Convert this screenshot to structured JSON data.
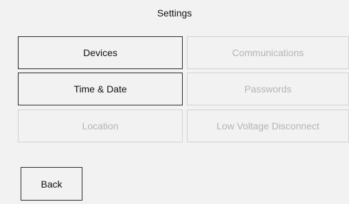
{
  "header": {
    "title": "Settings"
  },
  "menu": {
    "devices_label": "Devices",
    "communications_label": "Communications",
    "time_date_label": "Time & Date",
    "passwords_label": "Passwords",
    "location_label": "Location",
    "low_voltage_disconnect_label": "Low Voltage Disconnect"
  },
  "footer": {
    "back_label": "Back"
  },
  "colors": {
    "background": "#f2f2f2",
    "enabled_border": "#2a2a2a",
    "disabled_border": "#d2d2d2",
    "disabled_text": "#b4b4b4"
  }
}
